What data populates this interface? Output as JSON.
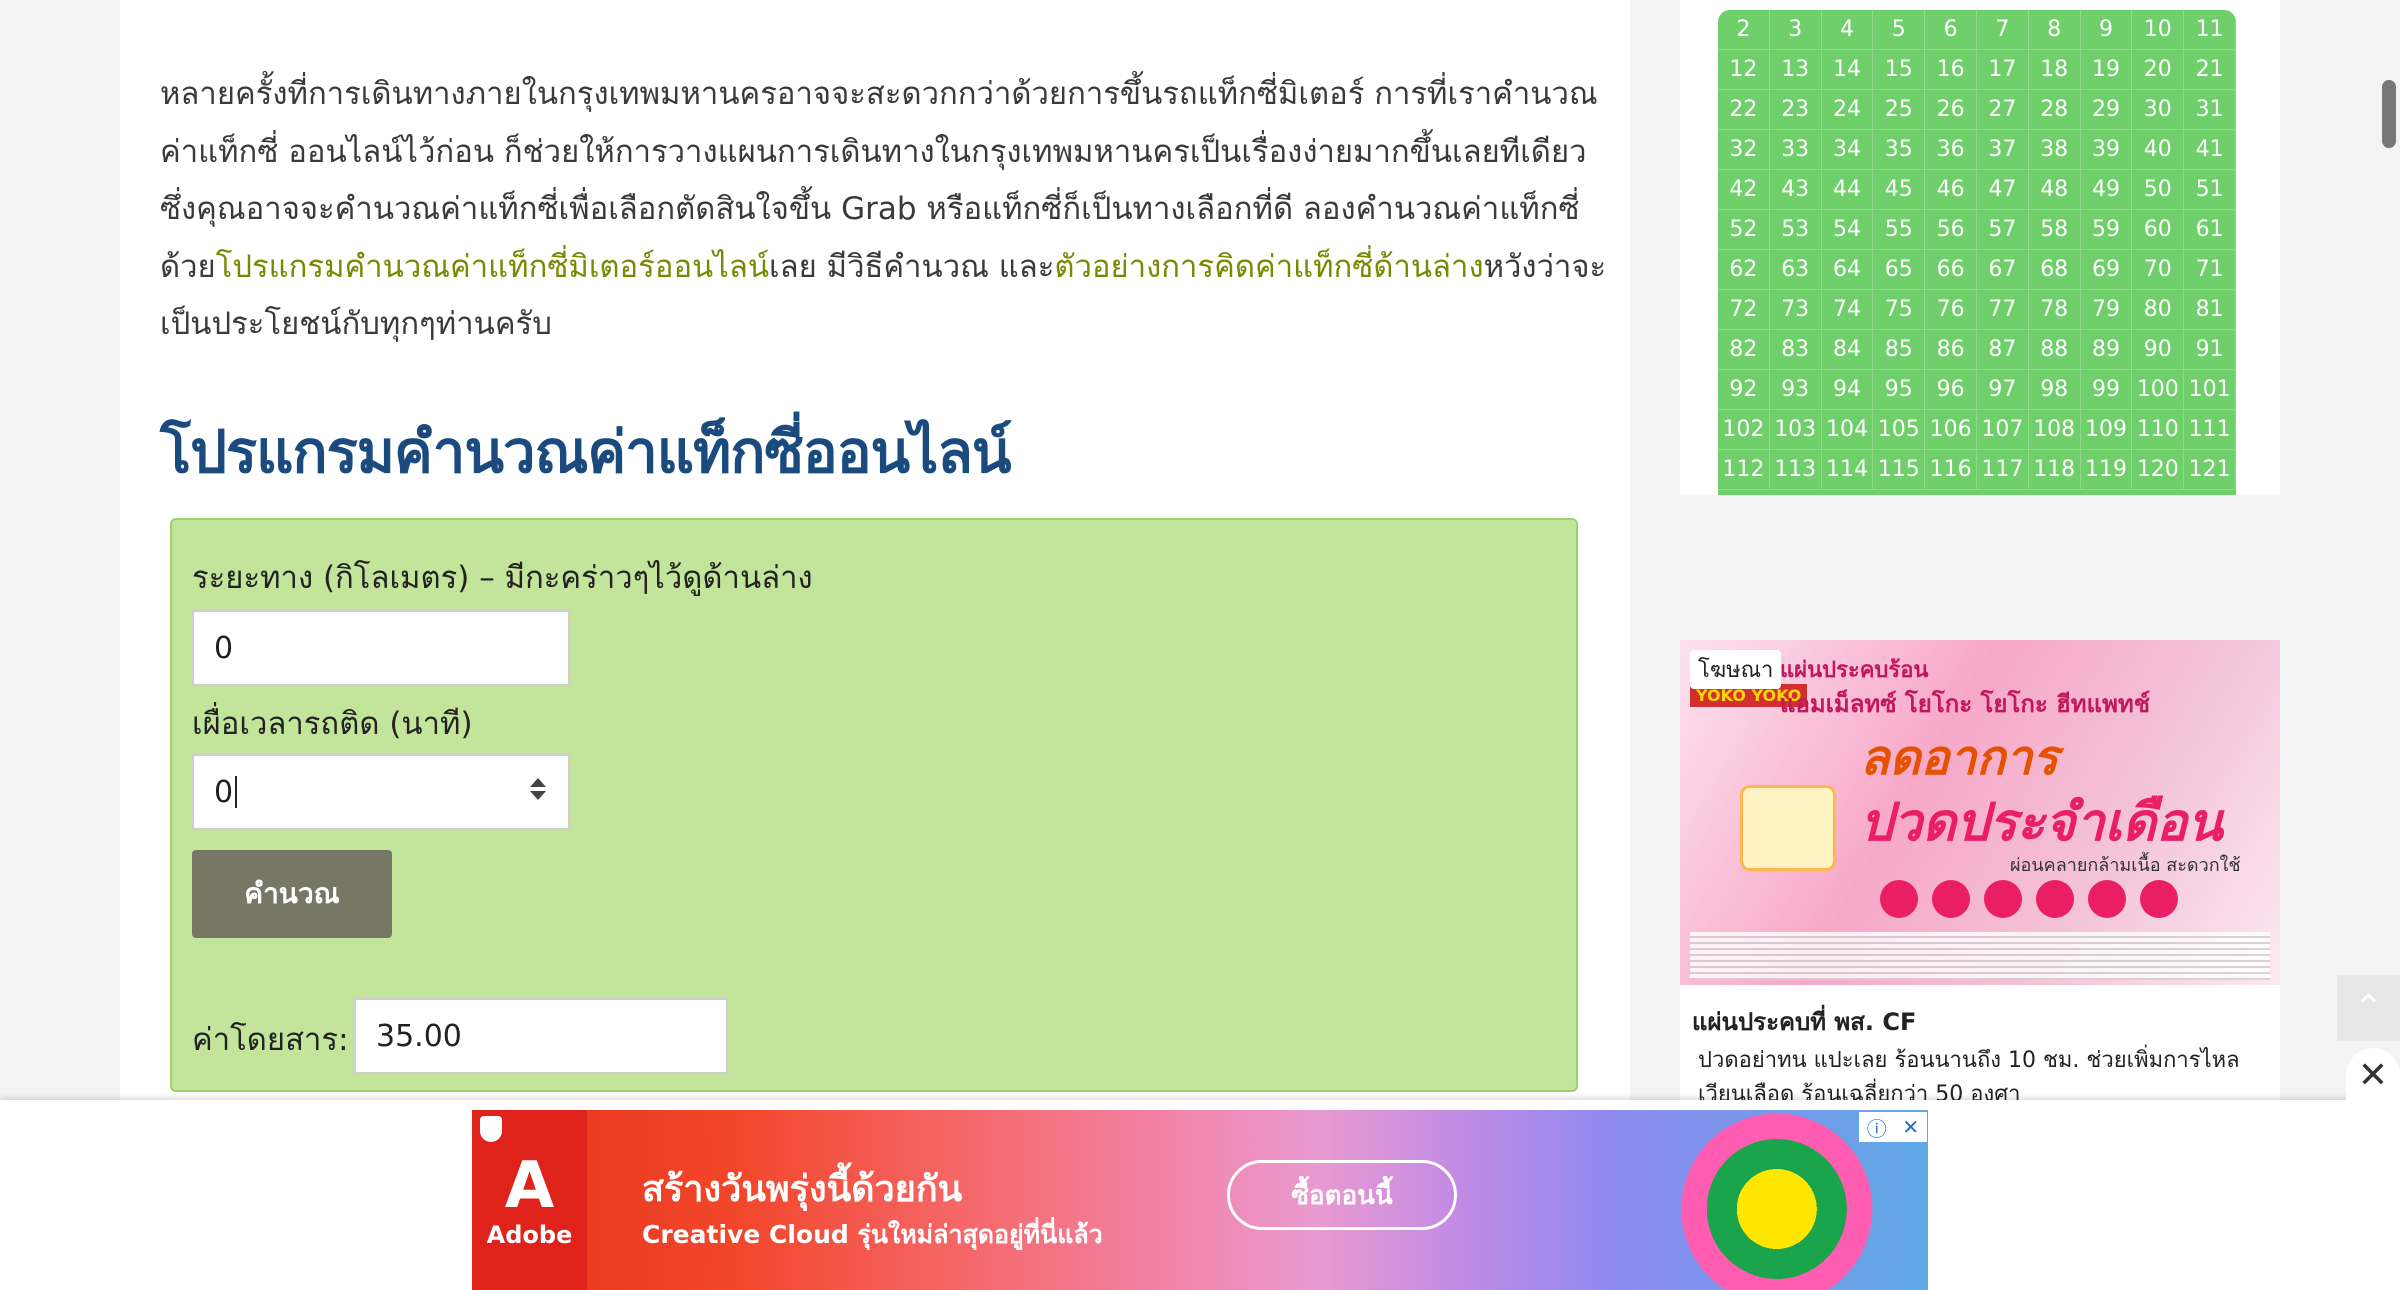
{
  "article": {
    "intro_part1": "หลายครั้งที่การเดินทางภายในกรุงเทพมหานครอาจจะสะดวกกว่าด้วยการขึ้นรถแท็กซี่มิเตอร์ การที่เราคำนวณค่าแท็กซี่ ออนไลน์ไว้ก่อน ก็ช่วยให้การวางแผนการเดินทางในกรุงเทพมหานครเป็นเรื่องง่ายมากขึ้นเลยทีเดียว ซึ่งคุณอาจจะคำนวณค่าแท็กซี่เพื่อเลือกตัดสินใจขึ้น Grab หรือแท็กซี่ก็เป็นทางเลือกที่ดี ลองคำนวณค่าแท็กซี่ด้วย",
    "link1": "โปรแกรมคำนวณค่าแท็กซี่มิเตอร์ออนไลน์",
    "intro_part2": "เลย มีวิธีคำนวณ และ",
    "link2": "ตัวอย่างการคิดค่าแท็กซี่ด้านล่าง",
    "intro_part3": "หวังว่าจะเป็นประโยชน์กับทุกๆท่านครับ",
    "heading": "โปรแกรมคำนวณค่าแท็กซี่ออนไลน์"
  },
  "calculator": {
    "distance_label": "ระยะทาง (กิโลเมตร) – มีกะคร่าวๆไว้ดูด้านล่าง",
    "distance_value": "0",
    "traffic_label": "เผื่อเวลารถติด (นาที)",
    "traffic_value": "0",
    "calc_button": "คำนวณ",
    "fare_label": "ค่าโดยสาร:",
    "fare_value": "35.00"
  },
  "sidebar": {
    "grid_numbers": [
      "2",
      "3",
      "4",
      "5",
      "6",
      "7",
      "8",
      "9",
      "10",
      "11",
      "12",
      "13",
      "14",
      "15",
      "16",
      "17",
      "18",
      "19",
      "20",
      "21",
      "22",
      "23",
      "24",
      "25",
      "26",
      "27",
      "28",
      "29",
      "30",
      "31",
      "32",
      "33",
      "34",
      "35",
      "36",
      "37",
      "38",
      "39",
      "40",
      "41",
      "42",
      "43",
      "44",
      "45",
      "46",
      "47",
      "48",
      "49",
      "50",
      "51",
      "52",
      "53",
      "54",
      "55",
      "56",
      "57",
      "58",
      "59",
      "60",
      "61",
      "62",
      "63",
      "64",
      "65",
      "66",
      "67",
      "68",
      "69",
      "70",
      "71",
      "72",
      "73",
      "74",
      "75",
      "76",
      "77",
      "78",
      "79",
      "80",
      "81",
      "82",
      "83",
      "84",
      "85",
      "86",
      "87",
      "88",
      "89",
      "90",
      "91",
      "92",
      "93",
      "94",
      "95",
      "96",
      "97",
      "98",
      "99",
      "100",
      "101",
      "102",
      "103",
      "104",
      "105",
      "106",
      "107",
      "108",
      "109",
      "110",
      "111",
      "112",
      "113",
      "114",
      "115",
      "116",
      "117",
      "118",
      "119",
      "120",
      "121"
    ],
    "ad_label": "โฆษณา",
    "ad_line1": "แผ่นประคบร้อน",
    "ad_brand": "YOKO YOKO",
    "ad_line2": "แอมเม็ลทซ์ โยโกะ โยโกะ ฮีทแพทช์",
    "ad_big1": "ลดอาการ",
    "ad_big2": "ปวดประจำเดือน",
    "ad_sub": "ผ่อนคลายกล้ามเนื้อ สะดวกใช้",
    "ad_title": "แผ่นประคบที่ พส. CF",
    "ad_desc": "ปวดอย่าทน แปะเลย ร้อนนานถึง 10 ชม. ช่วยเพิ่มการไหลเวียนเลือด ร้อนเฉลี่ยกว่า 50 องศา"
  },
  "bottom_ad": {
    "brand": "Adobe",
    "headline": "สร้างวันพรุ่งนี้ด้วยกัน",
    "subline": "Creative Cloud รุ่นใหม่ล่าสุดอยู่ที่นี่แล้ว",
    "cta": "ซื้อตอนนี้"
  },
  "colors": {
    "heading": "#1b4b7e",
    "link": "#7a8a00",
    "calc_bg": "#c3e59b",
    "grid_bg": "#6fcf6a"
  }
}
